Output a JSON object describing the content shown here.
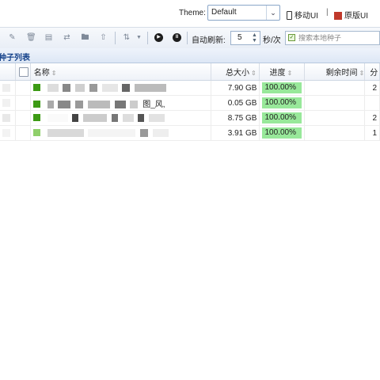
{
  "header": {
    "theme_label": "Theme:",
    "theme_value": "Default",
    "mobile_ui": "移动UI",
    "separator": "|",
    "original_ui": "原版UI"
  },
  "toolbar": {
    "refresh_label": "自动刷新:",
    "refresh_value": "5",
    "refresh_unit": "秒/次",
    "search_placeholder": "搜索本地种子",
    "search_checked": true
  },
  "panel": {
    "title": "种子列表"
  },
  "table": {
    "columns": [
      {
        "key": "check",
        "label": ""
      },
      {
        "key": "name",
        "label": "名称"
      },
      {
        "key": "size",
        "label": "总大小"
      },
      {
        "key": "progress",
        "label": "进度"
      },
      {
        "key": "remaining",
        "label": "剩余时间"
      },
      {
        "key": "more",
        "label": "分"
      }
    ],
    "rows": [
      {
        "name_visible": "",
        "size": "7.90 GB",
        "progress": "100.00%",
        "remaining": "",
        "more": "2"
      },
      {
        "name_visible": "图_风,",
        "size": "0.05 GB",
        "progress": "100.00%",
        "remaining": "",
        "more": ""
      },
      {
        "name_visible": "",
        "size": "8.75 GB",
        "progress": "100.00%",
        "remaining": "",
        "more": "2"
      },
      {
        "name_visible": "",
        "size": "3.91 GB",
        "progress": "100.00%",
        "remaining": "",
        "more": "1"
      }
    ]
  },
  "colors": {
    "progress_fill": "#98e89a",
    "status_square": "#3c9a14",
    "panel_title_text": "#15428b"
  }
}
